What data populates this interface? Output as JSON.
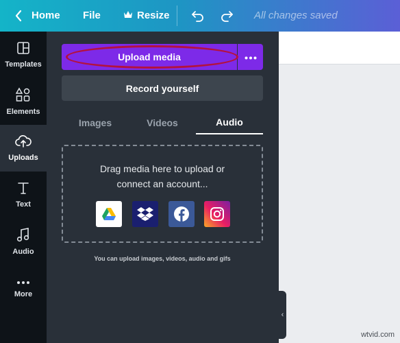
{
  "topbar": {
    "home_label": "Home",
    "file_label": "File",
    "resize_label": "Resize",
    "status": "All changes saved"
  },
  "sidebar": {
    "items": [
      {
        "label": "Templates",
        "icon": "templates-icon"
      },
      {
        "label": "Elements",
        "icon": "elements-icon"
      },
      {
        "label": "Uploads",
        "icon": "upload-cloud-icon",
        "active": true
      },
      {
        "label": "Text",
        "icon": "text-icon"
      },
      {
        "label": "Audio",
        "icon": "music-note-icon"
      },
      {
        "label": "More",
        "icon": "more-dots-icon"
      }
    ]
  },
  "panel": {
    "upload_label": "Upload media",
    "record_label": "Record yourself",
    "tabs": [
      {
        "label": "Images"
      },
      {
        "label": "Videos"
      },
      {
        "label": "Audio",
        "active": true
      }
    ],
    "drop_line1": "Drag media here to upload or",
    "drop_line2": "connect an account...",
    "services": [
      "google-drive-icon",
      "dropbox-icon",
      "facebook-icon",
      "instagram-icon"
    ],
    "hint": "You can upload images, videos, audio and gifs"
  },
  "watermark": "wtvid.com",
  "colors": {
    "accent": "#7d2ae8",
    "panel_bg": "#293039",
    "sidebar_bg": "#0e1318",
    "highlight_circle": "#b3123f"
  }
}
